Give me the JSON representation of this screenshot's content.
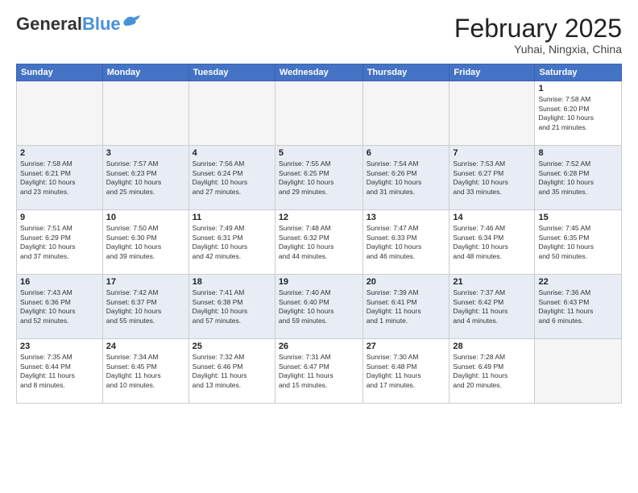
{
  "logo": {
    "general": "General",
    "blue": "Blue"
  },
  "title": "February 2025",
  "subtitle": "Yuhai, Ningxia, China",
  "days_header": [
    "Sunday",
    "Monday",
    "Tuesday",
    "Wednesday",
    "Thursday",
    "Friday",
    "Saturday"
  ],
  "weeks": [
    [
      {
        "num": "",
        "info": ""
      },
      {
        "num": "",
        "info": ""
      },
      {
        "num": "",
        "info": ""
      },
      {
        "num": "",
        "info": ""
      },
      {
        "num": "",
        "info": ""
      },
      {
        "num": "",
        "info": ""
      },
      {
        "num": "1",
        "info": "Sunrise: 7:58 AM\nSunset: 6:20 PM\nDaylight: 10 hours\nand 21 minutes."
      }
    ],
    [
      {
        "num": "2",
        "info": "Sunrise: 7:58 AM\nSunset: 6:21 PM\nDaylight: 10 hours\nand 23 minutes."
      },
      {
        "num": "3",
        "info": "Sunrise: 7:57 AM\nSunset: 6:23 PM\nDaylight: 10 hours\nand 25 minutes."
      },
      {
        "num": "4",
        "info": "Sunrise: 7:56 AM\nSunset: 6:24 PM\nDaylight: 10 hours\nand 27 minutes."
      },
      {
        "num": "5",
        "info": "Sunrise: 7:55 AM\nSunset: 6:25 PM\nDaylight: 10 hours\nand 29 minutes."
      },
      {
        "num": "6",
        "info": "Sunrise: 7:54 AM\nSunset: 6:26 PM\nDaylight: 10 hours\nand 31 minutes."
      },
      {
        "num": "7",
        "info": "Sunrise: 7:53 AM\nSunset: 6:27 PM\nDaylight: 10 hours\nand 33 minutes."
      },
      {
        "num": "8",
        "info": "Sunrise: 7:52 AM\nSunset: 6:28 PM\nDaylight: 10 hours\nand 35 minutes."
      }
    ],
    [
      {
        "num": "9",
        "info": "Sunrise: 7:51 AM\nSunset: 6:29 PM\nDaylight: 10 hours\nand 37 minutes."
      },
      {
        "num": "10",
        "info": "Sunrise: 7:50 AM\nSunset: 6:30 PM\nDaylight: 10 hours\nand 39 minutes."
      },
      {
        "num": "11",
        "info": "Sunrise: 7:49 AM\nSunset: 6:31 PM\nDaylight: 10 hours\nand 42 minutes."
      },
      {
        "num": "12",
        "info": "Sunrise: 7:48 AM\nSunset: 6:32 PM\nDaylight: 10 hours\nand 44 minutes."
      },
      {
        "num": "13",
        "info": "Sunrise: 7:47 AM\nSunset: 6:33 PM\nDaylight: 10 hours\nand 46 minutes."
      },
      {
        "num": "14",
        "info": "Sunrise: 7:46 AM\nSunset: 6:34 PM\nDaylight: 10 hours\nand 48 minutes."
      },
      {
        "num": "15",
        "info": "Sunrise: 7:45 AM\nSunset: 6:35 PM\nDaylight: 10 hours\nand 50 minutes."
      }
    ],
    [
      {
        "num": "16",
        "info": "Sunrise: 7:43 AM\nSunset: 6:36 PM\nDaylight: 10 hours\nand 52 minutes."
      },
      {
        "num": "17",
        "info": "Sunrise: 7:42 AM\nSunset: 6:37 PM\nDaylight: 10 hours\nand 55 minutes."
      },
      {
        "num": "18",
        "info": "Sunrise: 7:41 AM\nSunset: 6:38 PM\nDaylight: 10 hours\nand 57 minutes."
      },
      {
        "num": "19",
        "info": "Sunrise: 7:40 AM\nSunset: 6:40 PM\nDaylight: 10 hours\nand 59 minutes."
      },
      {
        "num": "20",
        "info": "Sunrise: 7:39 AM\nSunset: 6:41 PM\nDaylight: 11 hours\nand 1 minute."
      },
      {
        "num": "21",
        "info": "Sunrise: 7:37 AM\nSunset: 6:42 PM\nDaylight: 11 hours\nand 4 minutes."
      },
      {
        "num": "22",
        "info": "Sunrise: 7:36 AM\nSunset: 6:43 PM\nDaylight: 11 hours\nand 6 minutes."
      }
    ],
    [
      {
        "num": "23",
        "info": "Sunrise: 7:35 AM\nSunset: 6:44 PM\nDaylight: 11 hours\nand 8 minutes."
      },
      {
        "num": "24",
        "info": "Sunrise: 7:34 AM\nSunset: 6:45 PM\nDaylight: 11 hours\nand 10 minutes."
      },
      {
        "num": "25",
        "info": "Sunrise: 7:32 AM\nSunset: 6:46 PM\nDaylight: 11 hours\nand 13 minutes."
      },
      {
        "num": "26",
        "info": "Sunrise: 7:31 AM\nSunset: 6:47 PM\nDaylight: 11 hours\nand 15 minutes."
      },
      {
        "num": "27",
        "info": "Sunrise: 7:30 AM\nSunset: 6:48 PM\nDaylight: 11 hours\nand 17 minutes."
      },
      {
        "num": "28",
        "info": "Sunrise: 7:28 AM\nSunset: 6:49 PM\nDaylight: 11 hours\nand 20 minutes."
      },
      {
        "num": "",
        "info": ""
      }
    ]
  ]
}
